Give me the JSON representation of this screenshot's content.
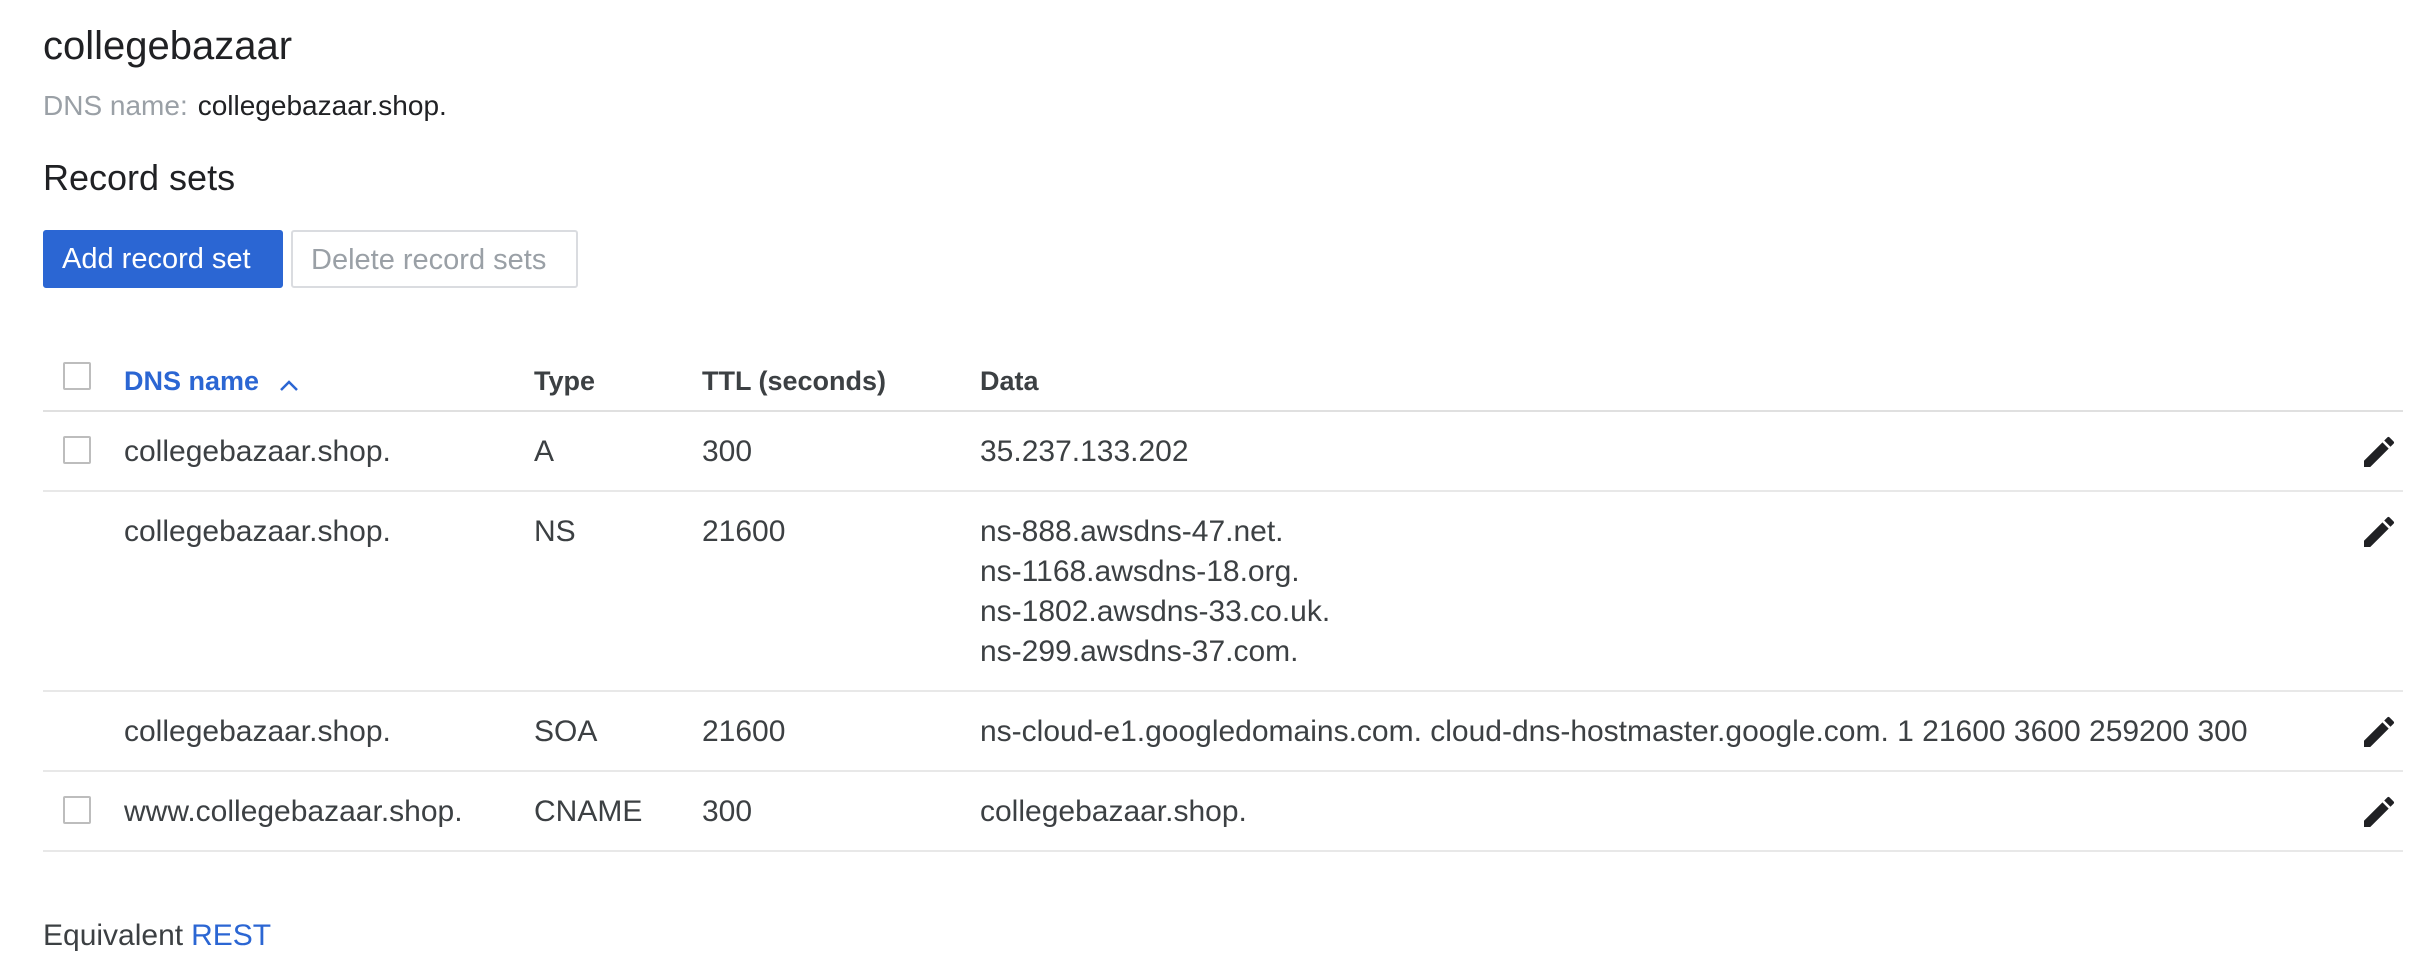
{
  "zone": {
    "title": "collegebazaar",
    "dns_name_label": "DNS name:",
    "dns_name_value": "collegebazaar.shop."
  },
  "record_sets": {
    "section_title": "Record sets",
    "add_button": "Add record set",
    "delete_button": "Delete record sets"
  },
  "table": {
    "columns": {
      "name": "DNS name",
      "type": "Type",
      "ttl": "TTL (seconds)",
      "data": "Data"
    },
    "sort": {
      "column": "DNS name",
      "direction": "ascending"
    },
    "rows": [
      {
        "name": "collegebazaar.shop.",
        "type": "A",
        "ttl": "300",
        "data": [
          "35.237.133.202"
        ],
        "selectable": true
      },
      {
        "name": "collegebazaar.shop.",
        "type": "NS",
        "ttl": "21600",
        "data": [
          "ns-888.awsdns-47.net.",
          "ns-1168.awsdns-18.org.",
          "ns-1802.awsdns-33.co.uk.",
          "ns-299.awsdns-37.com."
        ],
        "selectable": false
      },
      {
        "name": "collegebazaar.shop.",
        "type": "SOA",
        "ttl": "21600",
        "data": [
          "ns-cloud-e1.googledomains.com. cloud-dns-hostmaster.google.com. 1 21600 3600 259200 300"
        ],
        "selectable": false
      },
      {
        "name": "www.collegebazaar.shop.",
        "type": "CNAME",
        "ttl": "300",
        "data": [
          "collegebazaar.shop."
        ],
        "selectable": true
      }
    ]
  },
  "footer": {
    "prefix": "Equivalent",
    "link": "REST"
  },
  "colors": {
    "accent": "#2b66d3",
    "muted_text": "#9aa0a6",
    "body_text": "#3c4043"
  },
  "icons": {
    "row_action": "edit-pencil-icon",
    "sort": "chevron-up-icon"
  }
}
